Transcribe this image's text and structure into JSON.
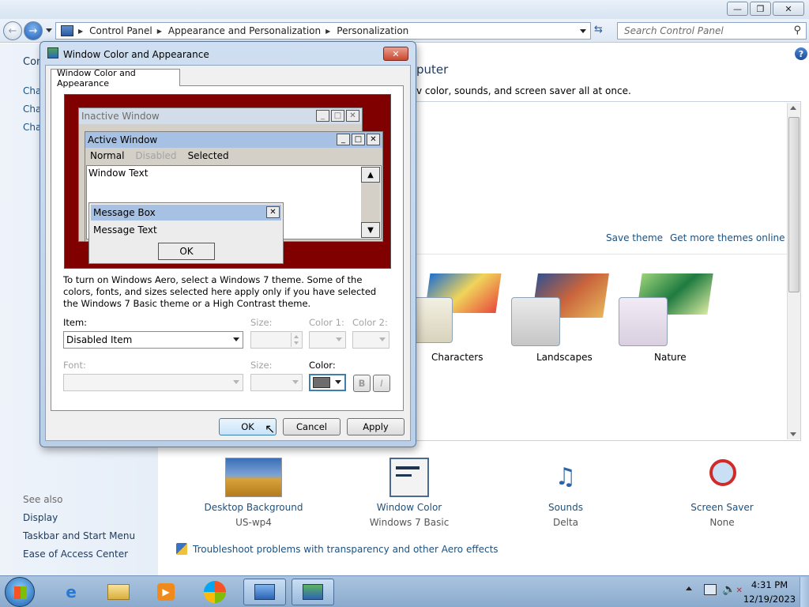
{
  "window": {
    "breadcrumb": [
      "Control Panel",
      "Appearance and Personalization",
      "Personalization"
    ],
    "search_placeholder": "Search Control Panel"
  },
  "sidebar": {
    "truncated_heading": "Con",
    "truncated_links": [
      "Cha",
      "Cha",
      "Cha"
    ],
    "see_also_label": "See also",
    "see_also_links": [
      "Display",
      "Taskbar and Start Menu",
      "Ease of Access Center"
    ]
  },
  "main": {
    "title_fragment": "puter",
    "subtitle_fragment": "v color, sounds, and screen saver all at once.",
    "save_theme": "Save theme",
    "get_more_themes": "Get more themes online",
    "themes": [
      "Characters",
      "Landscapes",
      "Nature"
    ],
    "bottom_items": [
      {
        "label": "Desktop Background",
        "value": "US-wp4"
      },
      {
        "label": "Window Color",
        "value": "Windows 7 Basic"
      },
      {
        "label": "Sounds",
        "value": "Delta"
      },
      {
        "label": "Screen Saver",
        "value": "None"
      }
    ],
    "troubleshoot_link": "Troubleshoot problems with transparency and other Aero effects"
  },
  "dialog": {
    "title": "Window Color and Appearance",
    "tab_label": "Window Color and Appearance",
    "preview": {
      "inactive_window": "Inactive Window",
      "active_window": "Active Window",
      "menu_normal": "Normal",
      "menu_disabled": "Disabled",
      "menu_selected": "Selected",
      "window_text": "Window Text",
      "message_box_title": "Message Box",
      "message_text": "Message Text",
      "message_ok": "OK"
    },
    "info_text": "To turn on Windows Aero, select a Windows 7 theme.  Some of the colors, fonts, and sizes selected here apply only if you have selected the Windows 7 Basic theme or a High Contrast theme.",
    "item_label": "Item:",
    "item_value": "Disabled Item",
    "size_label": "Size:",
    "color1_label": "Color 1:",
    "color2_label": "Color 2:",
    "font_label": "Font:",
    "size2_label": "Size:",
    "color_label": "Color:",
    "bold_label": "B",
    "italic_label": "I",
    "ok": "OK",
    "cancel": "Cancel",
    "apply": "Apply"
  },
  "taskbar": {
    "time": "4:31 PM",
    "date": "12/19/2023"
  },
  "colors": {
    "preview_background": "#800000",
    "active_caption": "#a6c1e3",
    "inactive_caption": "#d3dde9",
    "link": "#1c5180"
  }
}
